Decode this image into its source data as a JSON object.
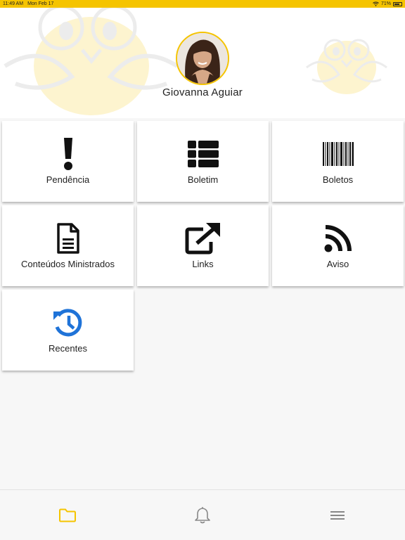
{
  "status_bar": {
    "time": "11:49 AM",
    "date": "Mon Feb 17",
    "battery": "71%"
  },
  "profile": {
    "name": "Giovanna Aguiar"
  },
  "menu": {
    "pendencia": "Pendência",
    "boletim": "Boletim",
    "boletos": "Boletos",
    "conteudos": "Conteúdos Ministrados",
    "links": "Links",
    "aviso": "Aviso",
    "recentes": "Recentes"
  },
  "colors": {
    "accent": "#f5c400",
    "recentes_icon": "#1f73d8"
  },
  "bottom_nav": [
    "folder-icon",
    "bell-icon",
    "menu-icon"
  ]
}
